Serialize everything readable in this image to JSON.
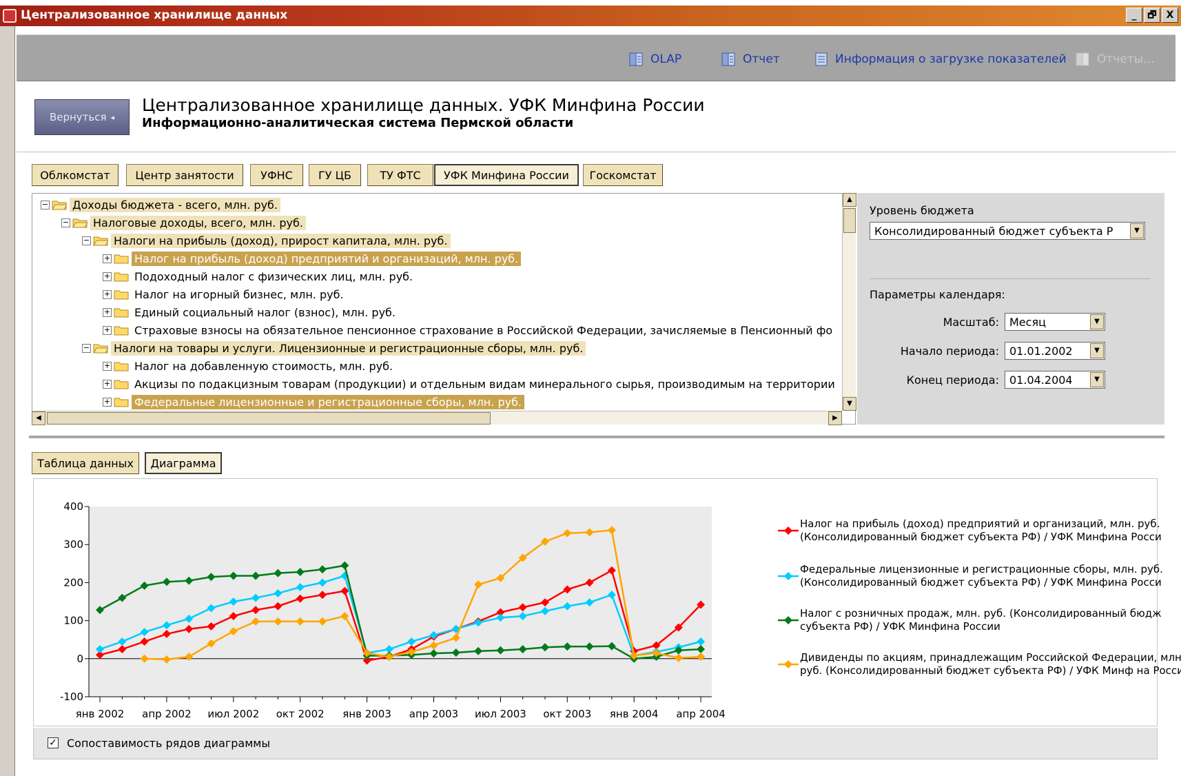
{
  "window": {
    "title": "Централизованное хранилище данных",
    "controls": [
      "_",
      "🗗",
      "X"
    ]
  },
  "toolbar": {
    "items": [
      {
        "label": "OLAP",
        "enabled": true
      },
      {
        "label": "Отчет",
        "enabled": true
      },
      {
        "label": "Информация о загрузке показателей",
        "enabled": true
      },
      {
        "label": "Отчеты...",
        "enabled": false
      }
    ]
  },
  "header": {
    "back_label": "Вернуться",
    "title": "Централизованное хранилище данных.   УФК Минфина России",
    "subtitle": "Информационно-аналитическая система Пермской области"
  },
  "source_tabs": [
    "Облкомстат",
    "Центр занятости",
    "УФНС",
    "ГУ ЦБ",
    "ТУ ФТС",
    "УФК Минфина России",
    "Госкомстат"
  ],
  "active_source_tab": 5,
  "tree": [
    {
      "label": "Доходы бюджета - всего, млн. руб.",
      "level": 0,
      "expanded": true,
      "style": "beige"
    },
    {
      "label": "Налоговые доходы, всего, млн. руб.",
      "level": 1,
      "expanded": true,
      "style": "beige"
    },
    {
      "label": "Налоги на прибыль (доход), прирост капитала, млн. руб.",
      "level": 2,
      "expanded": true,
      "style": "beige"
    },
    {
      "label": "Налог на прибыль (доход) предприятий и организаций, млн. руб.",
      "level": 3,
      "expanded": false,
      "style": "selected"
    },
    {
      "label": "Подоходный налог с физических лиц, млн. руб.",
      "level": 3,
      "expanded": false,
      "style": "none"
    },
    {
      "label": "Налог на игорный бизнес, млн. руб.",
      "level": 3,
      "expanded": false,
      "style": "none"
    },
    {
      "label": "Единый социальный налог (взнос), млн. руб.",
      "level": 3,
      "expanded": false,
      "style": "none"
    },
    {
      "label": "Страховые взносы на обязательное пенсионное страхование в Российской Федерации, зачисляемые в Пенсионный фо",
      "level": 3,
      "expanded": false,
      "style": "none"
    },
    {
      "label": "Налоги на товары и услуги. Лицензионные и регистрационные сборы, млн. руб.",
      "level": 2,
      "expanded": true,
      "style": "beige"
    },
    {
      "label": "Налог на добавленную стоимость, млн. руб.",
      "level": 3,
      "expanded": false,
      "style": "none"
    },
    {
      "label": "Акцизы по подакцизным товарам (продукции) и отдельным видам минерального сырья, производимым на территории",
      "level": 3,
      "expanded": false,
      "style": "none"
    },
    {
      "label": "Федеральные лицензионные и регистрационные сборы, млн. руб.",
      "level": 3,
      "expanded": false,
      "style": "selected"
    }
  ],
  "budget": {
    "label": "Уровень бюджета",
    "value": "Консолидированный бюджет субъекта Р"
  },
  "calendar": {
    "label": "Параметры календаря:",
    "scale_label": "Масштаб:",
    "scale_value": "Месяц",
    "start_label": "Начало периода:",
    "start_value": "01.01.2002",
    "end_label": "Конец периода:",
    "end_value": "01.04.2004"
  },
  "view_tabs": [
    "Таблица данных",
    "Диаграмма"
  ],
  "active_view_tab": 1,
  "checkbox": {
    "label": "Сопоставимость рядов диаграммы",
    "checked": true
  },
  "colors": {
    "red": "#ff0000",
    "cyan": "#00ccff",
    "green": "#007a1a",
    "orange": "#ffa500",
    "selected": "#c9a24d",
    "beige": "#efe2b8"
  },
  "chart_data": {
    "type": "line",
    "title": "",
    "xlabel": "",
    "ylabel": "",
    "ylim": [
      -100,
      400
    ],
    "yticks": [
      -100,
      0,
      100,
      200,
      300,
      400
    ],
    "x": [
      "янв 2002",
      "фев 2002",
      "мар 2002",
      "апр 2002",
      "май 2002",
      "июн 2002",
      "июл 2002",
      "авг 2002",
      "сен 2002",
      "окт 2002",
      "ноя 2002",
      "дек 2002",
      "янв 2003",
      "фев 2003",
      "мар 2003",
      "апр 2003",
      "май 2003",
      "июн 2003",
      "июл 2003",
      "авг 2003",
      "сен 2003",
      "окт 2003",
      "ноя 2003",
      "дек 2003",
      "янв 2004",
      "фев 2004",
      "мар 2004",
      "апр 2004"
    ],
    "xtick_labels": [
      "янв 2002",
      "апр 2002",
      "июл 2002",
      "окт 2002",
      "янв 2003",
      "апр 2003",
      "июл 2003",
      "окт 2003",
      "янв 2004",
      "апр 2004"
    ],
    "grid": false,
    "legend_position": "right",
    "series": [
      {
        "name": "Налог на прибыль (доход) предприятий и организаций, млн. руб. (Консолидированный бюджет субъекта РФ) / УФК Минфина Росси",
        "color": "#ff0000",
        "values": [
          10,
          25,
          45,
          65,
          78,
          85,
          112,
          128,
          138,
          158,
          168,
          178,
          -5,
          5,
          25,
          58,
          78,
          98,
          122,
          135,
          148,
          182,
          200,
          232,
          20,
          35,
          82,
          142
        ]
      },
      {
        "name": "Федеральные лицензионные и регистрационные сборы, млн. руб. (Консолидированный бюджет субъекта РФ) / УФК Минфина Росси",
        "color": "#00ccff",
        "values": [
          25,
          45,
          70,
          88,
          105,
          133,
          150,
          160,
          172,
          188,
          200,
          218,
          15,
          25,
          45,
          62,
          78,
          95,
          108,
          112,
          125,
          138,
          148,
          168,
          8,
          18,
          30,
          45
        ]
      },
      {
        "name": "Налог с розничных продаж, млн. руб. (Консолидированный бюдж субъекта РФ) / УФК Минфина России",
        "color": "#007a1a",
        "values": [
          128,
          160,
          192,
          202,
          205,
          215,
          218,
          218,
          225,
          228,
          235,
          245,
          8,
          8,
          10,
          14,
          16,
          20,
          22,
          25,
          30,
          32,
          32,
          33,
          0,
          5,
          22,
          25
        ]
      },
      {
        "name": "Дивиденды по акциям, принадлежащим Российской Федерации, млн. руб. (Консолидированный бюджет субъекта РФ) / УФК Минф на России",
        "color": "#ffa500",
        "values": [
          null,
          null,
          0,
          -2,
          5,
          40,
          72,
          98,
          98,
          98,
          98,
          112,
          15,
          5,
          18,
          35,
          55,
          195,
          212,
          265,
          308,
          330,
          332,
          338,
          8,
          15,
          2,
          5
        ]
      }
    ]
  }
}
